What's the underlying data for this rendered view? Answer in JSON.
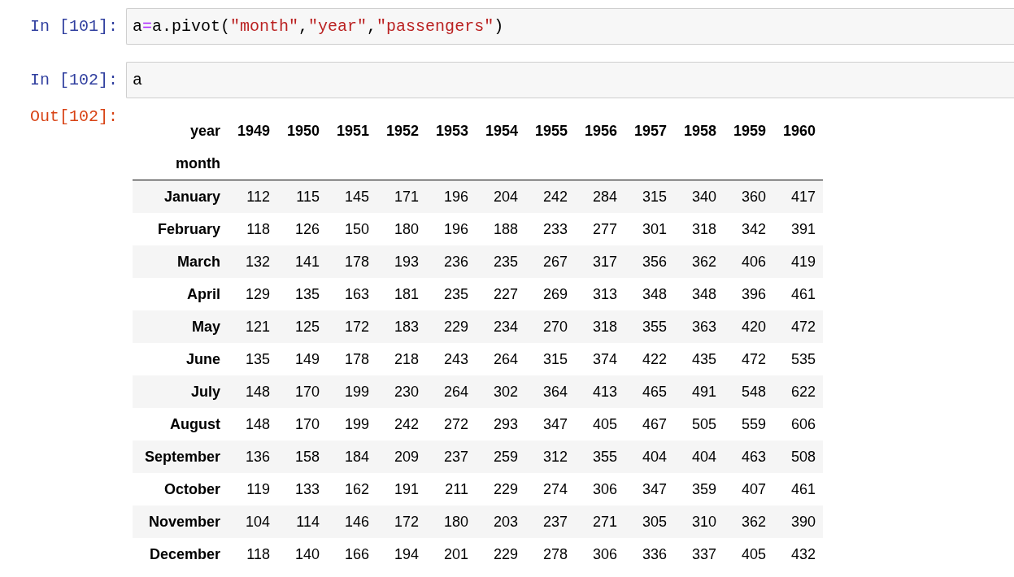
{
  "cells": [
    {
      "prompt": "In [101]:",
      "tokens": [
        {
          "text": "a",
          "kind": "name"
        },
        {
          "text": "=",
          "kind": "operator"
        },
        {
          "text": "a.pivot(",
          "kind": "name"
        },
        {
          "text": "\"month\"",
          "kind": "string"
        },
        {
          "text": ",",
          "kind": "name"
        },
        {
          "text": "\"year\"",
          "kind": "string"
        },
        {
          "text": ",",
          "kind": "name"
        },
        {
          "text": "\"passengers\"",
          "kind": "string"
        },
        {
          "text": ")",
          "kind": "name"
        }
      ]
    },
    {
      "prompt": "In [102]:",
      "tokens": [
        {
          "text": "a",
          "kind": "name"
        }
      ]
    }
  ],
  "output": {
    "prompt": "Out[102]:",
    "table": {
      "columns_name": "year",
      "index_name": "month",
      "columns": [
        "1949",
        "1950",
        "1951",
        "1952",
        "1953",
        "1954",
        "1955",
        "1956",
        "1957",
        "1958",
        "1959",
        "1960"
      ],
      "rows": [
        {
          "label": "January",
          "values": [
            "112",
            "115",
            "145",
            "171",
            "196",
            "204",
            "242",
            "284",
            "315",
            "340",
            "360",
            "417"
          ]
        },
        {
          "label": "February",
          "values": [
            "118",
            "126",
            "150",
            "180",
            "196",
            "188",
            "233",
            "277",
            "301",
            "318",
            "342",
            "391"
          ]
        },
        {
          "label": "March",
          "values": [
            "132",
            "141",
            "178",
            "193",
            "236",
            "235",
            "267",
            "317",
            "356",
            "362",
            "406",
            "419"
          ]
        },
        {
          "label": "April",
          "values": [
            "129",
            "135",
            "163",
            "181",
            "235",
            "227",
            "269",
            "313",
            "348",
            "348",
            "396",
            "461"
          ]
        },
        {
          "label": "May",
          "values": [
            "121",
            "125",
            "172",
            "183",
            "229",
            "234",
            "270",
            "318",
            "355",
            "363",
            "420",
            "472"
          ]
        },
        {
          "label": "June",
          "values": [
            "135",
            "149",
            "178",
            "218",
            "243",
            "264",
            "315",
            "374",
            "422",
            "435",
            "472",
            "535"
          ]
        },
        {
          "label": "July",
          "values": [
            "148",
            "170",
            "199",
            "230",
            "264",
            "302",
            "364",
            "413",
            "465",
            "491",
            "548",
            "622"
          ]
        },
        {
          "label": "August",
          "values": [
            "148",
            "170",
            "199",
            "242",
            "272",
            "293",
            "347",
            "405",
            "467",
            "505",
            "559",
            "606"
          ]
        },
        {
          "label": "September",
          "values": [
            "136",
            "158",
            "184",
            "209",
            "237",
            "259",
            "312",
            "355",
            "404",
            "404",
            "463",
            "508"
          ]
        },
        {
          "label": "October",
          "values": [
            "119",
            "133",
            "162",
            "191",
            "211",
            "229",
            "274",
            "306",
            "347",
            "359",
            "407",
            "461"
          ]
        },
        {
          "label": "November",
          "values": [
            "104",
            "114",
            "146",
            "172",
            "180",
            "203",
            "237",
            "271",
            "305",
            "310",
            "362",
            "390"
          ]
        },
        {
          "label": "December",
          "values": [
            "118",
            "140",
            "166",
            "194",
            "201",
            "229",
            "278",
            "306",
            "336",
            "337",
            "405",
            "432"
          ]
        }
      ]
    }
  }
}
